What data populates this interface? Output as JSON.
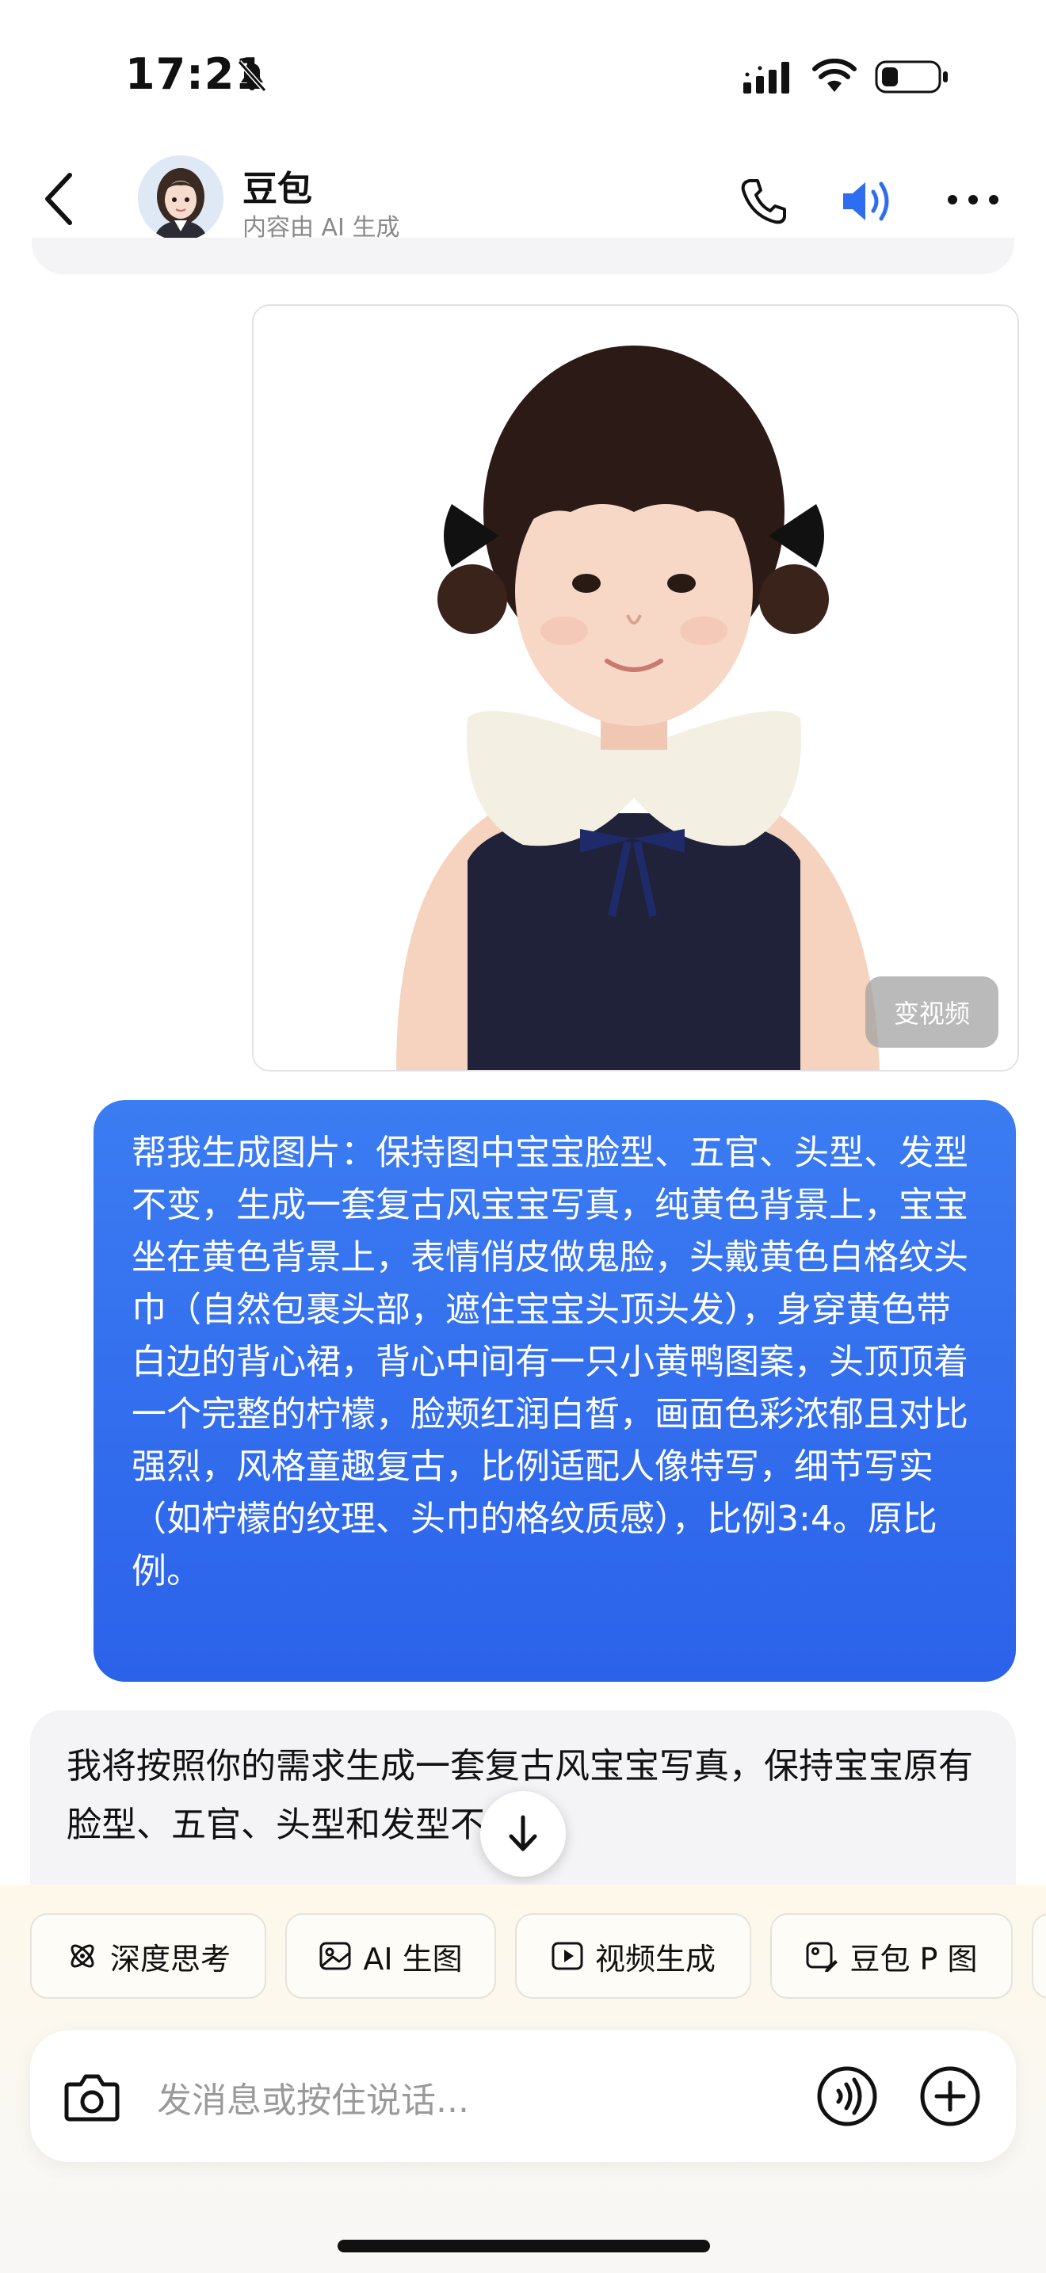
{
  "status_bar": {
    "time": "17:21"
  },
  "header": {
    "bot_name": "豆包",
    "subtitle": "内容由 AI 生成"
  },
  "image_card": {
    "video_button": "变视频"
  },
  "user_message": "帮我生成图片：保持图中宝宝脸型、五官、头型、发型不变，生成一套复古风宝宝写真，纯黄色背景上，宝宝坐在黄色背景上，表情俏皮做鬼脸，头戴黄色白格纹头巾（自然包裹头部，遮住宝宝头顶头发），身穿黄色带白边的背心裙，背心中间有一只小黄鸭图案，头顶顶着一个完整的柠檬，脸颊红润白皙，画面色彩浓郁且对比强烈，风格童趣复古，比例适配人像特写，细节写实（如柠檬的纹理、头巾的格纹质感），比例3:4。原比例。",
  "bot_message": "我将按照你的需求生成一套复古风宝宝写真，保持宝宝原有脸型、五官、头型和发型不变。",
  "chips": [
    {
      "label": "深度思考",
      "icon": "atom-icon"
    },
    {
      "label": "AI 生图",
      "icon": "image-icon"
    },
    {
      "label": "视频生成",
      "icon": "video-icon"
    },
    {
      "label": "豆包 P 图",
      "icon": "photo-edit-icon"
    }
  ],
  "input": {
    "placeholder": "发消息或按住说话..."
  },
  "colors": {
    "accent": "#2b62ea",
    "bubble_gray": "#f4f4f6",
    "speaker_blue": "#2f6df0"
  }
}
